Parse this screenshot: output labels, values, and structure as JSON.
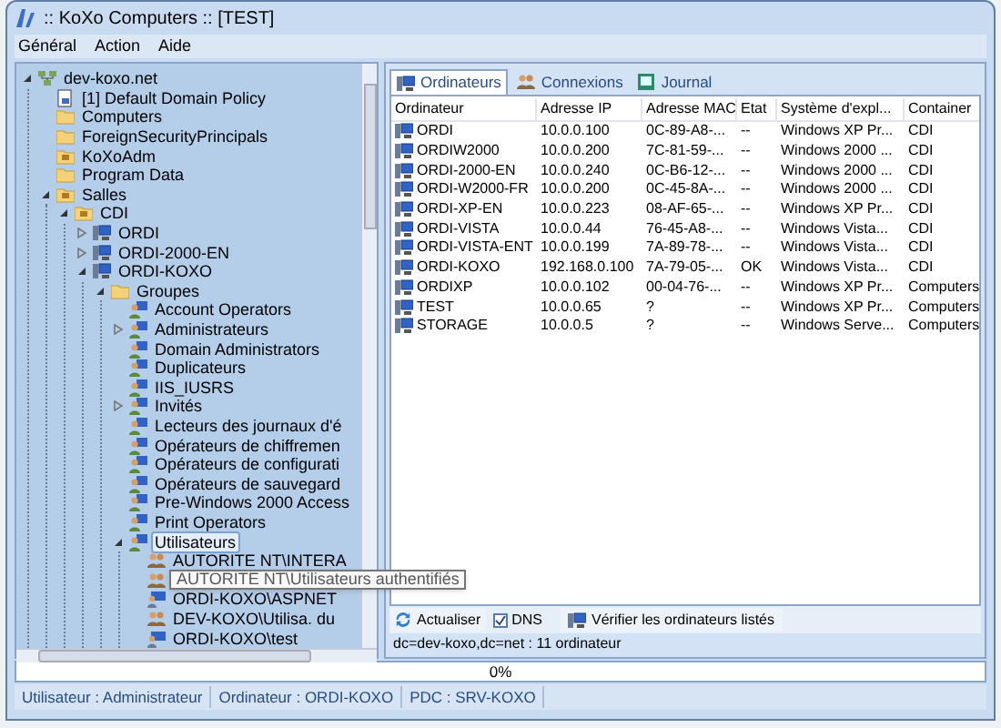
{
  "window": {
    "title": ":: KoXo Computers :: [TEST]"
  },
  "menu": [
    "Général",
    "Action",
    "Aide"
  ],
  "tree": [
    {
      "label": "dev-koxo.net",
      "kind": "domain",
      "expanded": true,
      "selected": false,
      "children": [
        {
          "label": "[1] Default Domain Policy",
          "kind": "policy",
          "selected": false
        },
        {
          "label": "Computers",
          "kind": "folder",
          "selected": false
        },
        {
          "label": "ForeignSecurityPrincipals",
          "kind": "folder",
          "selected": false
        },
        {
          "label": "KoXoAdm",
          "kind": "ou",
          "selected": false
        },
        {
          "label": "Program Data",
          "kind": "folder",
          "selected": false
        },
        {
          "label": "Salles",
          "kind": "ou",
          "expanded": true,
          "selected": false,
          "children": [
            {
              "label": "CDI",
              "kind": "ou",
              "expanded": true,
              "selected": false,
              "children": [
                {
                  "label": "ORDI",
                  "kind": "computer",
                  "expanded": false,
                  "selected": false
                },
                {
                  "label": "ORDI-2000-EN",
                  "kind": "computer",
                  "expanded": false,
                  "selected": false
                },
                {
                  "label": "ORDI-KOXO",
                  "kind": "computer",
                  "expanded": true,
                  "selected": false,
                  "children": [
                    {
                      "label": "Groupes",
                      "kind": "folder",
                      "expanded": true,
                      "selected": false,
                      "children": [
                        {
                          "label": "Account Operators",
                          "kind": "group",
                          "selected": false
                        },
                        {
                          "label": "Administrateurs",
                          "kind": "group",
                          "expanded": false,
                          "selected": false
                        },
                        {
                          "label": "Domain Administrators",
                          "kind": "group",
                          "selected": false
                        },
                        {
                          "label": "Duplicateurs",
                          "kind": "group",
                          "selected": false
                        },
                        {
                          "label": "IIS_IUSRS",
                          "kind": "group",
                          "selected": false
                        },
                        {
                          "label": "Invités",
                          "kind": "group",
                          "expanded": false,
                          "selected": false
                        },
                        {
                          "label": "Lecteurs des journaux d'é",
                          "kind": "group",
                          "selected": false
                        },
                        {
                          "label": "Opérateurs de chiffremen",
                          "kind": "group",
                          "selected": false
                        },
                        {
                          "label": "Opérateurs de configurati",
                          "kind": "group",
                          "selected": false
                        },
                        {
                          "label": "Opérateurs de sauvegard",
                          "kind": "group",
                          "selected": false
                        },
                        {
                          "label": "Pre-Windows 2000 Access",
                          "kind": "group",
                          "selected": false
                        },
                        {
                          "label": "Print Operators",
                          "kind": "group",
                          "selected": false
                        },
                        {
                          "label": "Utilisateurs",
                          "kind": "group",
                          "expanded": true,
                          "selected": true,
                          "children": [
                            {
                              "label": "AUTORITE NT\\INTERA",
                              "kind": "members",
                              "selected": false
                            },
                            {
                              "kind": "members",
                              "selected": false,
                              "tooltip": "AUTORITE NT\\Utilisateurs authentifiés"
                            },
                            {
                              "label": "ORDI-KOXO\\ASPNET",
                              "kind": "user",
                              "selected": false
                            },
                            {
                              "label": "DEV-KOXO\\Utilisa. du",
                              "kind": "members",
                              "selected": false
                            },
                            {
                              "label": "ORDI-KOXO\\test",
                              "kind": "user",
                              "selected": false
                            }
                          ]
                        }
                      ]
                    }
                  ]
                }
              ]
            }
          ]
        }
      ]
    }
  ],
  "tabs": [
    {
      "label": "Ordinateurs",
      "kind": "computer",
      "selected": true
    },
    {
      "label": "Connexions",
      "kind": "members",
      "selected": false
    },
    {
      "label": "Journal",
      "kind": "journal",
      "selected": false
    }
  ],
  "table": {
    "columns": [
      "Ordinateur",
      "Adresse IP",
      "Adresse MAC",
      "Etat",
      "Système d'expl...",
      "Container"
    ],
    "rows": [
      [
        "ORDI",
        "10.0.0.100",
        "0C-89-A8-...",
        "--",
        "Windows XP Pr...",
        "CDI"
      ],
      [
        "ORDIW2000",
        "10.0.0.200",
        "7C-81-59-...",
        "--",
        "Windows 2000 ...",
        "CDI"
      ],
      [
        "ORDI-2000-EN",
        "10.0.0.240",
        "0C-B6-12-...",
        "--",
        "Windows 2000 ...",
        "CDI"
      ],
      [
        "ORDI-W2000-FR",
        "10.0.0.200",
        "0C-45-8A-...",
        "--",
        "Windows 2000 ...",
        "CDI"
      ],
      [
        "ORDI-XP-EN",
        "10.0.0.223",
        "08-AF-65-...",
        "--",
        "Windows XP Pr...",
        "CDI"
      ],
      [
        "ORDI-VISTA",
        "10.0.0.44",
        "76-45-A8-...",
        "--",
        "Windows Vista...",
        "CDI"
      ],
      [
        "ORDI-VISTA-ENT",
        "10.0.0.199",
        "7A-89-78-...",
        "--",
        "Windows Vista...",
        "CDI"
      ],
      [
        "ORDI-KOXO",
        "192.168.0.100",
        "7A-79-05-...",
        "OK",
        "Windows Vista...",
        "CDI"
      ],
      [
        "ORDIXP",
        "10.0.0.102",
        "00-04-76-...",
        "--",
        "Windows XP Pr...",
        "Computers"
      ],
      [
        "TEST",
        "10.0.0.65",
        "?",
        "--",
        "Windows XP Pr...",
        "Computers"
      ],
      [
        "STORAGE",
        "10.0.0.5",
        "?",
        "--",
        "Windows Serve...",
        "Computers"
      ]
    ]
  },
  "toolbar": {
    "refresh": "Actualiser",
    "dns": {
      "label": "DNS",
      "checked": true
    },
    "verify": "Vérifier les ordinateurs listés"
  },
  "info": "dc=dev-koxo,dc=net : 11 ordinateur",
  "progress": {
    "text": "0%",
    "level": 0
  },
  "status_bar": [
    "Utilisateur : Administrateur",
    "Ordinateur : ORDI-KOXO",
    "PDC : SRV-KOXO"
  ]
}
